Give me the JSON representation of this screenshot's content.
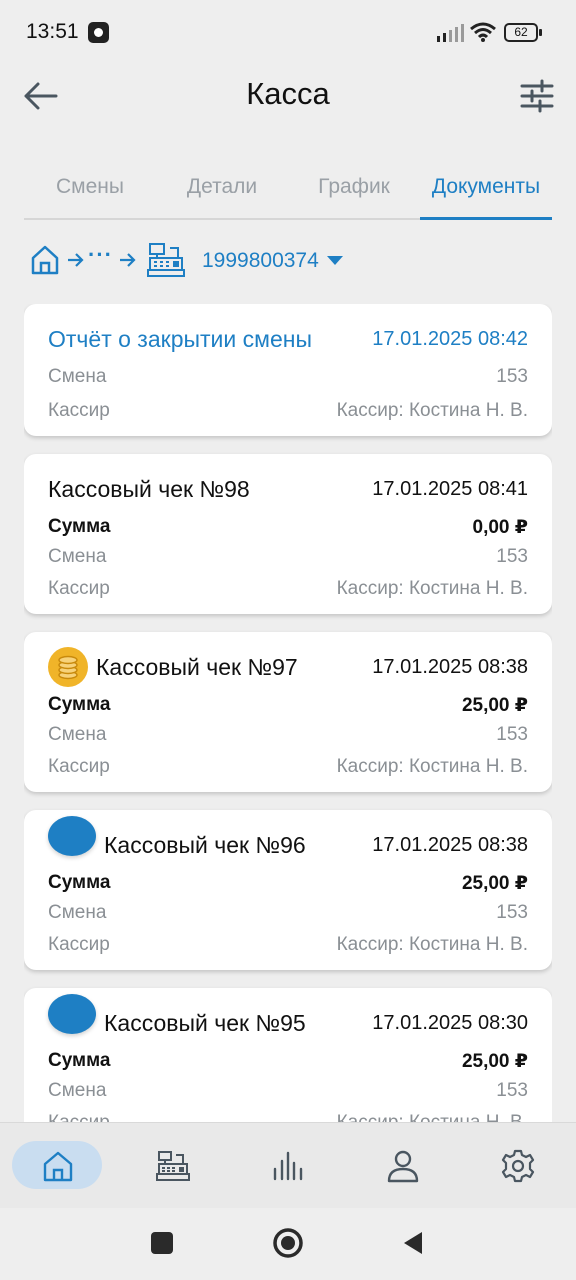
{
  "status_bar": {
    "time": "13:51",
    "battery": "62"
  },
  "app_bar": {
    "title": "Касса",
    "back_icon": "arrow-left-icon",
    "filter_icon": "sliders-icon"
  },
  "tabs": [
    {
      "label": "Смены",
      "active": false
    },
    {
      "label": "Детали",
      "active": false
    },
    {
      "label": "График",
      "active": false
    },
    {
      "label": "Документы",
      "active": true
    }
  ],
  "breadcrumb": {
    "dots": "···",
    "register_id": "1999800374"
  },
  "documents": [
    {
      "title": "Отчёт о закрытии смены",
      "date": "17.01.2025 08:42",
      "highlight": true,
      "icon": "",
      "shift_label": "Смена",
      "shift_value": "153",
      "cashier_label": "Кассир",
      "cashier_value": "Кассир: Костина Н. В."
    },
    {
      "title": "Кассовый чек №98",
      "date": "17.01.2025 08:41",
      "highlight": false,
      "icon": "",
      "sum_label": "Сумма",
      "sum_value": "0,00 ₽",
      "shift_label": "Смена",
      "shift_value": "153",
      "cashier_label": "Кассир",
      "cashier_value": "Кассир: Костина Н. В."
    },
    {
      "title": "Кассовый чек №97",
      "date": "17.01.2025 08:38",
      "highlight": false,
      "icon": "coins-icon",
      "sum_label": "Сумма",
      "sum_value": "25,00 ₽",
      "shift_label": "Смена",
      "shift_value": "153",
      "cashier_label": "Кассир",
      "cashier_value": "Кассир: Костина Н. В."
    },
    {
      "title": "Кассовый чек №96",
      "date": "17.01.2025 08:38",
      "highlight": false,
      "icon": "credit-card-icon",
      "sum_label": "Сумма",
      "sum_value": "25,00 ₽",
      "shift_label": "Смена",
      "shift_value": "153",
      "cashier_label": "Кассир",
      "cashier_value": "Кассир: Костина Н. В."
    },
    {
      "title": "Кассовый чек №95",
      "date": "17.01.2025 08:30",
      "highlight": false,
      "icon": "credit-card-icon",
      "sum_label": "Сумма",
      "sum_value": "25,00 ₽",
      "shift_label": "Смена",
      "shift_value": "153",
      "cashier_label": "Кассир",
      "cashier_value": "Кассир: Костина Н. В."
    }
  ],
  "bottom_nav": [
    {
      "icon": "home-icon",
      "active": true
    },
    {
      "icon": "cash-register-icon",
      "active": false
    },
    {
      "icon": "bar-chart-icon",
      "active": false
    },
    {
      "icon": "user-icon",
      "active": false
    },
    {
      "icon": "gear-icon",
      "active": false
    }
  ],
  "colors": {
    "accent": "#1e7fc4",
    "coin": "#f0b429",
    "background": "#eeeeee",
    "nav_active_pill": "#c9ddf0"
  }
}
